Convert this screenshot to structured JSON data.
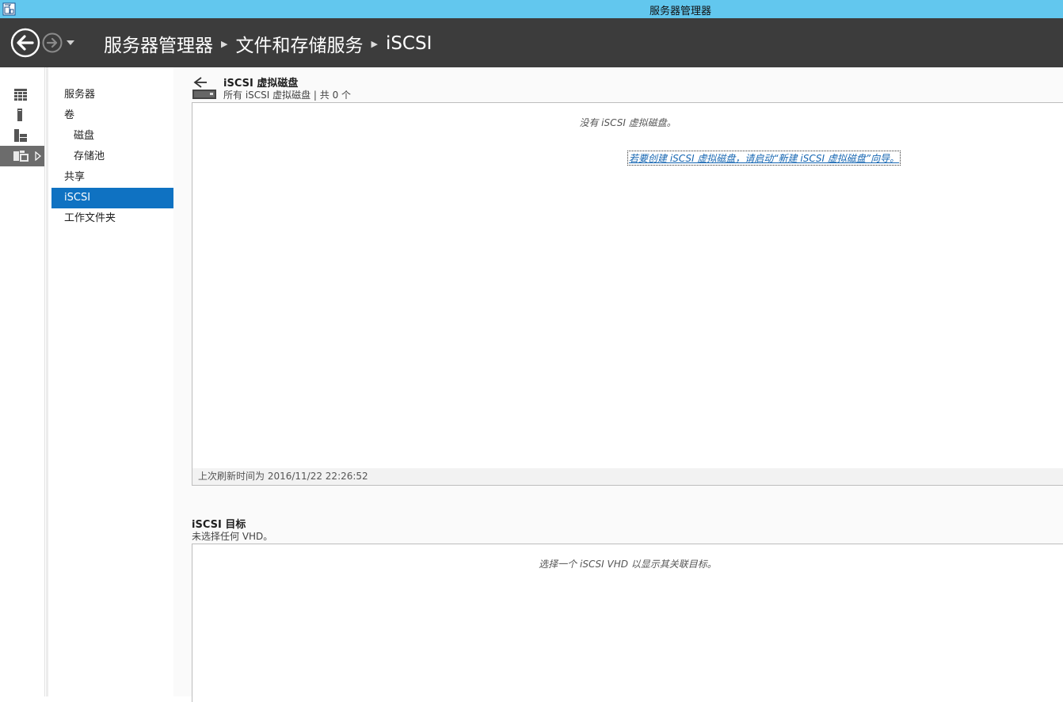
{
  "window": {
    "title": "服务器管理器"
  },
  "breadcrumb": [
    "服务器管理器",
    "文件和存储服务",
    "iSCSI"
  ],
  "nav": {
    "items": [
      {
        "label": "服务器",
        "sub": false,
        "selected": false
      },
      {
        "label": "卷",
        "sub": false,
        "selected": false
      },
      {
        "label": "磁盘",
        "sub": true,
        "selected": false
      },
      {
        "label": "存储池",
        "sub": true,
        "selected": false
      },
      {
        "label": "共享",
        "sub": false,
        "selected": false
      },
      {
        "label": "iSCSI",
        "sub": false,
        "selected": true
      },
      {
        "label": "工作文件夹",
        "sub": false,
        "selected": false
      }
    ]
  },
  "iconbar": [
    "dashboard-icon",
    "local-server-icon",
    "all-servers-icon",
    "file-storage-icon"
  ],
  "vdisks": {
    "title": "iSCSI 虚拟磁盘",
    "subtitle": "所有 iSCSI 虚拟磁盘 | 共 0 个",
    "empty_message": "没有 iSCSI 虚拟磁盘。",
    "create_link": "若要创建 iSCSI 虚拟磁盘，请启动“新建 iSCSI 虚拟磁盘”向导。",
    "last_refresh": "上次刷新时间为 2016/11/22 22:26:52"
  },
  "targets": {
    "title": "iSCSI 目标",
    "subtitle": "未选择任何 VHD。",
    "empty_message": "选择一个 iSCSI VHD 以显示其关联目标。"
  },
  "colors": {
    "titlebar": "#62c7ee",
    "header": "#3c3c3c",
    "selected": "#0f72c2",
    "link": "#1666b2"
  }
}
